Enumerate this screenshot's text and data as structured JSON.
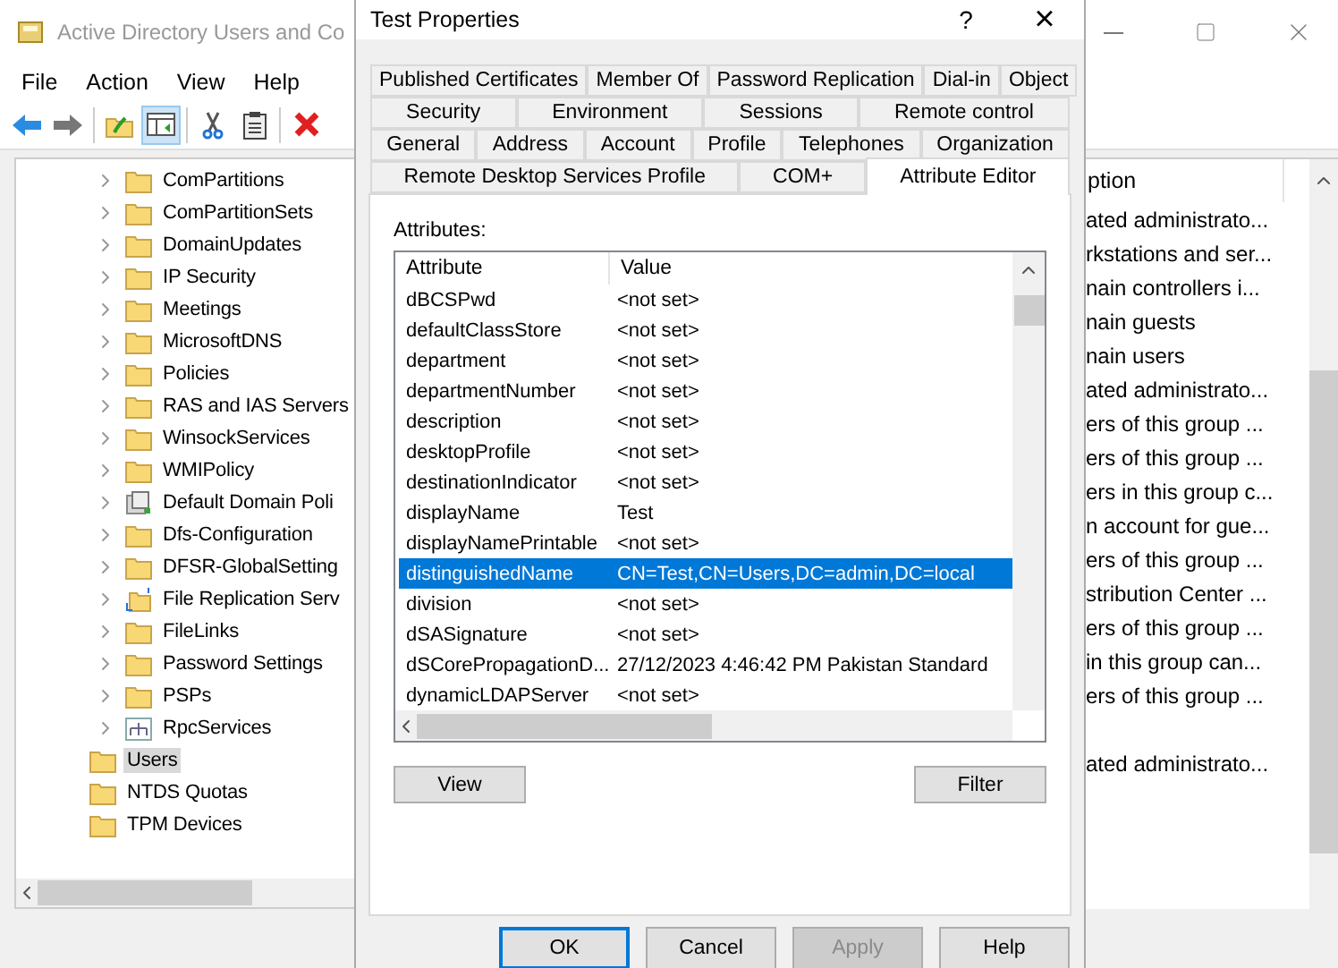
{
  "main_window": {
    "title": "Active Directory Users and Co",
    "menu": [
      "File",
      "Action",
      "View",
      "Help"
    ],
    "toolbar": [
      {
        "kind": "back",
        "pressed": false
      },
      {
        "kind": "forward",
        "pressed": false
      },
      {
        "kind": "up",
        "pressed": false
      },
      {
        "kind": "pane",
        "pressed": true
      },
      {
        "kind": "cut",
        "pressed": false
      },
      {
        "kind": "paste",
        "pressed": false
      },
      {
        "kind": "delete",
        "pressed": false
      }
    ],
    "tree": [
      {
        "children": [
          {
            "label": "ComPartitions",
            "kind": "folder",
            "selected": false
          },
          {
            "label": "ComPartitionSets",
            "kind": "folder",
            "selected": false
          },
          {
            "label": "DomainUpdates",
            "kind": "folder",
            "selected": false
          },
          {
            "label": "IP Security",
            "kind": "folder",
            "selected": false
          },
          {
            "label": "Meetings",
            "kind": "folder",
            "selected": false
          },
          {
            "label": "MicrosoftDNS",
            "kind": "folder",
            "selected": false
          },
          {
            "label": "Policies",
            "kind": "folder",
            "selected": false
          },
          {
            "label": "RAS and IAS Servers",
            "kind": "folder",
            "selected": false
          },
          {
            "label": "WinsockServices",
            "kind": "folder",
            "selected": false
          },
          {
            "label": "WMIPolicy",
            "kind": "folder",
            "selected": false
          },
          {
            "label": "Default Domain Poli",
            "kind": "policy",
            "selected": false
          },
          {
            "label": "Dfs-Configuration",
            "kind": "folder",
            "selected": false
          },
          {
            "label": "DFSR-GlobalSetting",
            "kind": "folder",
            "selected": false
          },
          {
            "label": "File Replication Serv",
            "kind": "replication",
            "selected": false
          },
          {
            "label": "FileLinks",
            "kind": "folder",
            "selected": false
          },
          {
            "label": "Password Settings",
            "kind": "folder",
            "selected": false
          },
          {
            "label": "PSPs",
            "kind": "folder",
            "selected": false
          },
          {
            "label": "RpcServices",
            "kind": "network",
            "selected": false
          }
        ]
      },
      {
        "label": "Users",
        "kind": "folder",
        "selected": true
      },
      {
        "label": "NTDS Quotas",
        "kind": "folder",
        "selected": false
      },
      {
        "label": "TPM Devices",
        "kind": "folder",
        "selected": false
      }
    ],
    "details": {
      "column_header": "ption",
      "rows": [
        {
          "text": "ated administrato..."
        },
        {
          "text": "rkstations and ser..."
        },
        {
          "text": "nain controllers i..."
        },
        {
          "text": "nain guests"
        },
        {
          "text": "nain users"
        },
        {
          "text": "ated administrato..."
        },
        {
          "text": "ers of this group ..."
        },
        {
          "text": "ers of this group ..."
        },
        {
          "text": "ers in this group c..."
        },
        {
          "text": "n account for gue..."
        },
        {
          "text": "ers of this group ..."
        },
        {
          "text": "stribution Center ..."
        },
        {
          "text": "ers of this group ..."
        },
        {
          "text": "in this group can..."
        },
        {
          "text": "ers of this group ..."
        },
        {
          "blank": true
        },
        {
          "text": "ated administrato..."
        }
      ]
    }
  },
  "dialog": {
    "title": "Test Properties",
    "help": "?",
    "close": "×",
    "tab_rows": [
      [
        {
          "label": "Published Certificates",
          "selected": false
        },
        {
          "label": "Member Of",
          "selected": false
        },
        {
          "label": "Password Replication",
          "selected": false
        },
        {
          "label": "Dial-in",
          "selected": false
        },
        {
          "label": "Object",
          "selected": false
        }
      ],
      [
        {
          "label": "Security",
          "selected": false
        },
        {
          "label": "Environment",
          "selected": false
        },
        {
          "label": "Sessions",
          "selected": false
        },
        {
          "label": "Remote control",
          "selected": false
        }
      ],
      [
        {
          "label": "General",
          "selected": false
        },
        {
          "label": "Address",
          "selected": false
        },
        {
          "label": "Account",
          "selected": false
        },
        {
          "label": "Profile",
          "selected": false
        },
        {
          "label": "Telephones",
          "selected": false
        },
        {
          "label": "Organization",
          "selected": false
        }
      ],
      [
        {
          "label": "Remote Desktop Services Profile",
          "selected": false
        },
        {
          "label": "COM+",
          "selected": false
        },
        {
          "label": "Attribute Editor",
          "selected": true
        }
      ]
    ],
    "attributes_label": "Attributes:",
    "columns": [
      "Attribute",
      "Value"
    ],
    "rows": [
      {
        "attribute": "dBCSPwd",
        "value": "<not set>",
        "selected": false
      },
      {
        "attribute": "defaultClassStore",
        "value": "<not set>",
        "selected": false
      },
      {
        "attribute": "department",
        "value": "<not set>",
        "selected": false
      },
      {
        "attribute": "departmentNumber",
        "value": "<not set>",
        "selected": false
      },
      {
        "attribute": "description",
        "value": "<not set>",
        "selected": false
      },
      {
        "attribute": "desktopProfile",
        "value": "<not set>",
        "selected": false
      },
      {
        "attribute": "destinationIndicator",
        "value": "<not set>",
        "selected": false
      },
      {
        "attribute": "displayName",
        "value": "Test",
        "selected": false
      },
      {
        "attribute": "displayNamePrintable",
        "value": "<not set>",
        "selected": false
      },
      {
        "attribute": "distinguishedName",
        "value": "CN=Test,CN=Users,DC=admin,DC=local",
        "selected": true
      },
      {
        "attribute": "division",
        "value": "<not set>",
        "selected": false
      },
      {
        "attribute": "dSASignature",
        "value": "<not set>",
        "selected": false
      },
      {
        "attribute": "dSCorePropagationD...",
        "value": "27/12/2023 4:46:42 PM Pakistan Standard",
        "selected": false
      },
      {
        "attribute": "dynamicLDAPServer",
        "value": "<not set>",
        "selected": false
      }
    ],
    "panel_buttons": [
      "View",
      "Filter"
    ],
    "footer_buttons": [
      {
        "label": "OK",
        "default": true,
        "disabled": false
      },
      {
        "label": "Cancel",
        "default": false,
        "disabled": false
      },
      {
        "label": "Apply",
        "default": false,
        "disabled": true
      },
      {
        "label": "Help",
        "default": false,
        "disabled": false
      }
    ]
  }
}
